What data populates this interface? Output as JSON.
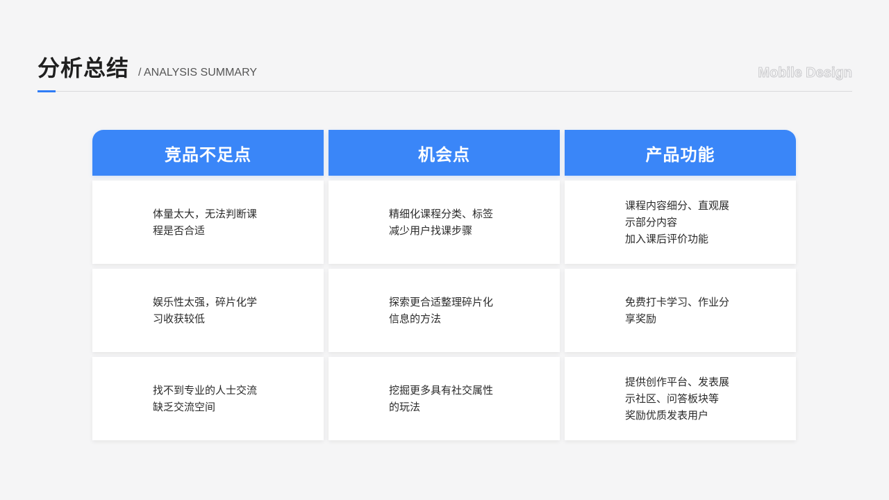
{
  "header": {
    "title": "分析总结",
    "subtitle": "/ ANALYSIS SUMMARY",
    "brand": "Mobile Design"
  },
  "colors": {
    "accent": "#3a86f8",
    "background": "#f5f5f6"
  },
  "table": {
    "columns": [
      "竞品不足点",
      "机会点",
      "产品功能"
    ],
    "rows": [
      [
        "体量太大，无法判断课\n程是否合适",
        "精细化课程分类、标签\n减少用户找课步骤",
        "课程内容细分、直观展\n示部分内容\n加入课后评价功能"
      ],
      [
        "娱乐性太强，碎片化学\n习收获较低",
        "探索更合适整理碎片化\n信息的方法",
        "免费打卡学习、作业分\n享奖励"
      ],
      [
        "找不到专业的人士交流\n缺乏交流空间",
        "挖掘更多具有社交属性\n的玩法",
        "提供创作平台、发表展\n示社区、问答板块等\n奖励优质发表用户"
      ]
    ]
  }
}
